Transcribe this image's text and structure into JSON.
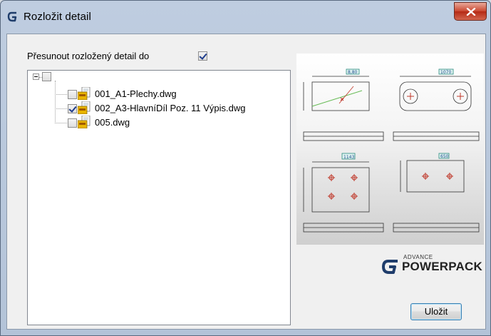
{
  "window": {
    "title": "Rozložit detail"
  },
  "options": {
    "move_label": "Přesunout rozložený detail do",
    "move_checked": true
  },
  "tree": {
    "root_checked": false,
    "items": [
      {
        "label": "001_A1-Plechy.dwg",
        "checked": false
      },
      {
        "label": "002_A3-HlavníDíl Poz. 11 Výpis.dwg",
        "checked": true
      },
      {
        "label": "005.dwg",
        "checked": false
      }
    ]
  },
  "preview": {
    "callouts": [
      "8,80",
      "1070",
      "1143",
      "650"
    ]
  },
  "logo": {
    "small_text": "ADVANCE",
    "main_text": "POWERPACK"
  },
  "buttons": {
    "save_label": "Uložit"
  },
  "colors": {
    "title_bar": "#b3c3d8",
    "close_button": "#c9462f",
    "check_mark": "#1e3c8c",
    "drawing_red": "#c0392b"
  }
}
